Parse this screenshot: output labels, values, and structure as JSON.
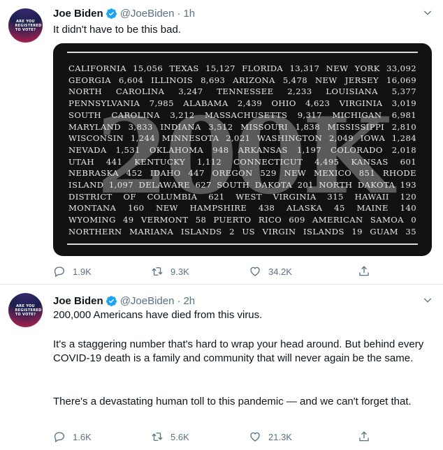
{
  "colors": {
    "secondary_text": "#5b7083",
    "verified_blue": "#1da1f2",
    "divider": "#e1e8ed",
    "media_bg": "#121212"
  },
  "tweets": [
    {
      "avatar_text": "ARE YOU REGISTERED TO VOTE?",
      "name": "Joe Biden",
      "handle": "@JoeBiden",
      "separator": "·",
      "time": "1h",
      "text": "It didn't have to be this bad.",
      "media": {
        "big_number": "200K",
        "lines": [
          "CALIFORNIA 15,056 TEXAS 15,127 FLORIDA 13,317 NEW YORK 33,092",
          "GEORGIA 6,604 ILLINOIS 8,693 ARIZONA 5,478 NEW JERSEY 16,069",
          "NORTH CAROLINA 3,247 TENNESSEE 2,233 LOUISIANA 5,377",
          "PENNSYLVANIA 7,985 ALABAMA 2,439 OHIO 4,623 VIRGINIA 3,019",
          "SOUTH CAROLINA 3,212 MASSACHUSETTS 9,317 MICHIGAN 6,981",
          "MARYLAND 3,833 INDIANA 3,512 MISSOURI 1,838 MISSISSIPPI 2,810",
          "WISCONSIN 1,244 MINNESOTA 2,021 WASHINGTON 2,049 IOWA 1,284",
          "NEVADA 1,531 OKLAHOMA 948 ARKANSAS 1,197 COLORADO 2,018",
          "UTAH 441 KENTUCKY 1,112 CONNECTICUT 4,495 KANSAS 601",
          "NEBRASKA 452 IDAHO 447 OREGON 529 NEW MEXICO 851 RHODE",
          "ISLAND 1,097 DELAWARE 627 SOUTH DAKOTA 201 NORTH DAKOTA 193",
          "DISTRICT OF COLUMBIA 621 WEST VIRGINIA 315 HAWAII 120",
          "MONTANA 160 NEW HAMPSHIRE 438 ALASKA 45 MAINE 140",
          "WYOMING 49 VERMONT 58 PUERTO RICO 609 AMERICAN SAMOA 0",
          "NORTHERN MARIANA ISLANDS 2 US VIRGIN ISLANDS 19 GUAM 35"
        ]
      },
      "actions": {
        "reply": "1.9K",
        "retweet": "9.3K",
        "like": "34.2K"
      }
    },
    {
      "avatar_text": "ARE YOU REGISTERED TO VOTE?",
      "name": "Joe Biden",
      "handle": "@JoeBiden",
      "separator": "·",
      "time": "2h",
      "paragraphs": [
        "200,000 Americans have died from this virus.",
        "It's a staggering number that's hard to wrap your head around. But behind every COVID-19 death is a family and community that will never again be the same.",
        "There's a devastating human toll to this pandemic — and we can't forget that."
      ],
      "actions": {
        "reply": "1.6K",
        "retweet": "5.6K",
        "like": "21.3K"
      }
    }
  ]
}
